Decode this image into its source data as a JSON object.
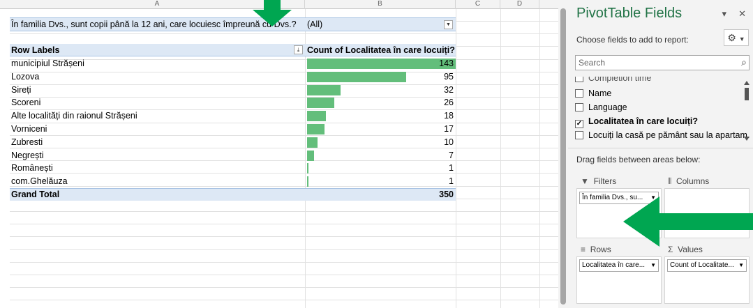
{
  "sheet": {
    "columns": [
      "A",
      "B",
      "C",
      "D"
    ],
    "filter": {
      "label": "În familia Dvs., sunt copii până la 12 ani, care locuiesc împreună cu Dvs.?",
      "value": "(All)"
    },
    "header": {
      "row_labels": "Row Labels",
      "value_col": "Count of Localitatea în care locuiți?"
    },
    "rows": [
      {
        "label": "municipiul Strășeni",
        "value": "143"
      },
      {
        "label": "Lozova",
        "value": "95"
      },
      {
        "label": "Sireți",
        "value": "32"
      },
      {
        "label": "Scoreni",
        "value": "26"
      },
      {
        "label": "Alte localități din raionul Strășeni",
        "value": "18"
      },
      {
        "label": "Vorniceni",
        "value": "17"
      },
      {
        "label": "Zubresti",
        "value": "10"
      },
      {
        "label": "Negrești",
        "value": "7"
      },
      {
        "label": "Românești",
        "value": "1"
      },
      {
        "label": "com.Ghelăuza",
        "value": "1"
      }
    ],
    "total": {
      "label": "Grand Total",
      "value": "350"
    },
    "databar_color": "#63be7b"
  },
  "pane": {
    "title": "PivotTable Fields",
    "choose": "Choose fields to add to report:",
    "search_placeholder": "Search",
    "fields": [
      {
        "label": "Completion time",
        "checked": false
      },
      {
        "label": "Name",
        "checked": false
      },
      {
        "label": "Language",
        "checked": false
      },
      {
        "label": "Localitatea în care locuiți?",
        "checked": true
      },
      {
        "label": "Locuiți la casă pe pământ sau la apartam...",
        "checked": false
      }
    ],
    "drag_text": "Drag fields between areas below:",
    "areas": {
      "filters": {
        "label": "Filters",
        "chip": "În familia Dvs., su..."
      },
      "columns": {
        "label": "Columns"
      },
      "rows": {
        "label": "Rows",
        "chip": "Localitatea în care..."
      },
      "values": {
        "label": "Values",
        "chip": "Count of Localitate..."
      }
    },
    "accent": "#217346"
  },
  "annotation_color": "#00a651"
}
